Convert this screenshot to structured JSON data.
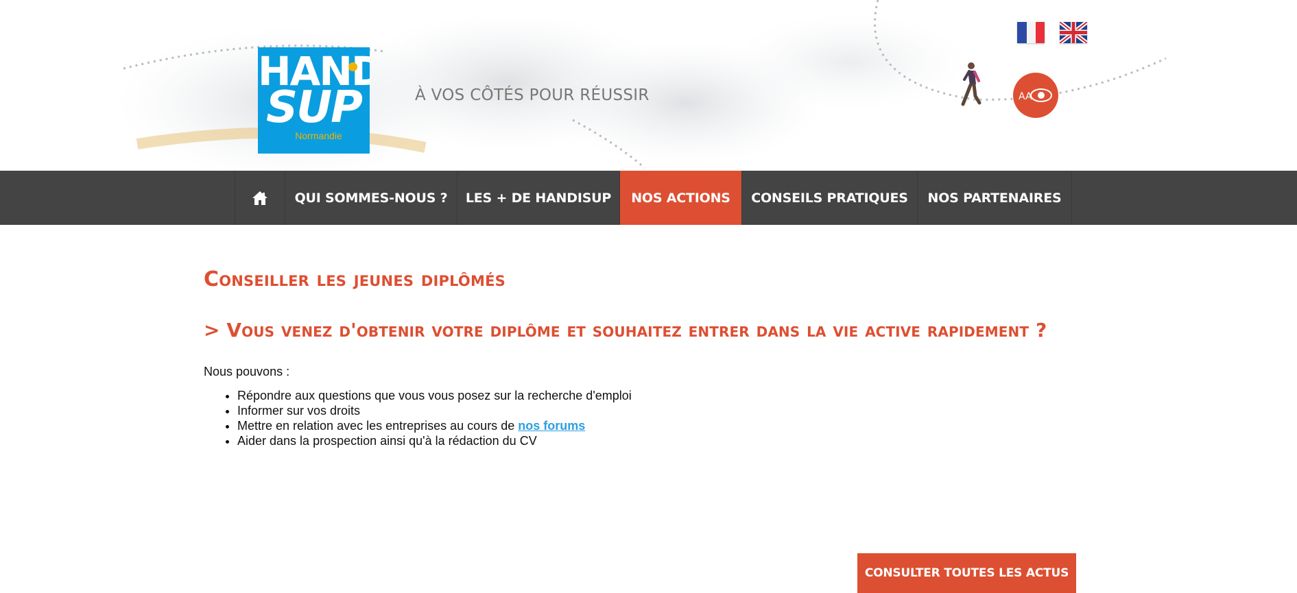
{
  "header": {
    "logo": {
      "line1": "HANDI",
      "line2": "SUP",
      "line3": "Normandie"
    },
    "tagline": "À VOS CÔTÉS POUR RÉUSSIR",
    "flags": [
      {
        "name": "french-flag",
        "icon": "flag-fr"
      },
      {
        "name": "english-flag",
        "icon": "flag-uk"
      }
    ],
    "accessibility_label": "AA",
    "accessibility_icon": "eye-icon",
    "mascot_icon": "walking-person-icon"
  },
  "nav": {
    "home_icon": "home-icon",
    "items": [
      {
        "label": "QUI SOMMES-NOUS ?"
      },
      {
        "label": "LES + DE HANDISUP"
      },
      {
        "label": "NOS ACTIONS",
        "active": true
      },
      {
        "label": "CONSEILS PRATIQUES"
      },
      {
        "label": "NOS PARTENAIRES"
      }
    ]
  },
  "main": {
    "title": "Conseiller les jeunes diplômés",
    "subtitle": "> Vous venez d'obtenir votre diplôme et souhaitez entrer dans la vie active rapidement ?",
    "intro": "Nous pouvons :",
    "bullets": [
      {
        "text": "Répondre aux questions que vous vous posez sur la recherche d'emploi"
      },
      {
        "text": "Informer sur vos droits"
      },
      {
        "text": "Mettre en relation avec les entreprises au cours de ",
        "link": "nos forums"
      },
      {
        "text": "Aider dans la prospection ainsi qu'à la rédaction du CV"
      }
    ],
    "cta": "CONSULTER TOUTES LES ACTUS"
  },
  "colors": {
    "accent": "#dd4f32",
    "nav_bg": "#444444",
    "logo_blue": "#0a9ee0",
    "logo_yellow": "#f2b200",
    "link": "#2aa0e0"
  }
}
